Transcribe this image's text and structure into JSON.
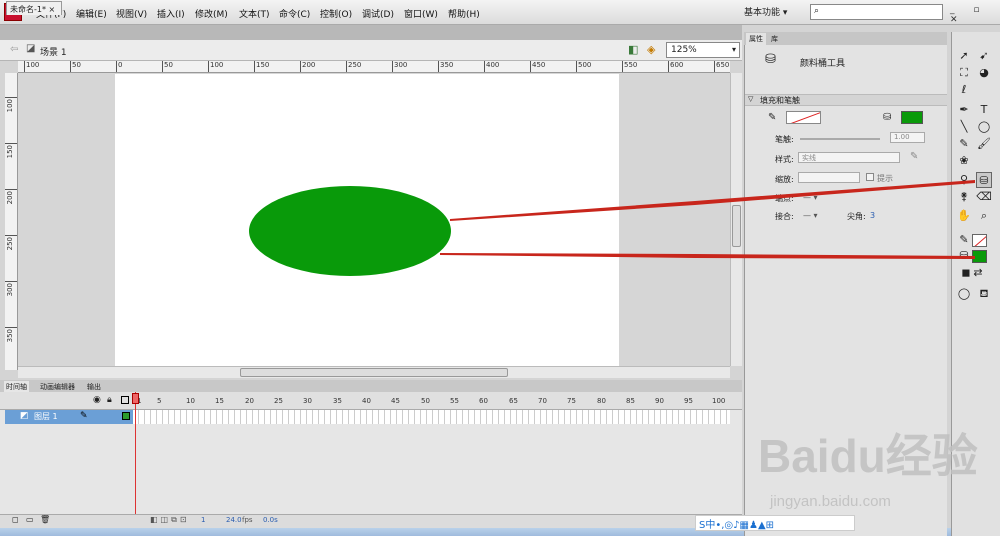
{
  "app": {
    "logo": "Fl"
  },
  "menu": [
    "文件(F)",
    "编辑(E)",
    "视图(V)",
    "插入(I)",
    "修改(M)",
    "文本(T)",
    "命令(C)",
    "控制(O)",
    "调试(D)",
    "窗口(W)",
    "帮助(H)"
  ],
  "workspace": "基本功能 ▾",
  "window_controls": "_ ▫ ✕",
  "document": {
    "tab": "未命名-1*",
    "close": "×",
    "scene": "场景 1",
    "zoom": "125%"
  },
  "ruler_h": [
    "100",
    "50",
    "0",
    "50",
    "100",
    "150",
    "200",
    "250",
    "300",
    "350",
    "400",
    "450",
    "500",
    "550",
    "600",
    "650"
  ],
  "ruler_v": [
    "100",
    "150",
    "200",
    "250",
    "300",
    "350"
  ],
  "timeline": {
    "tabs": [
      "时间轴",
      "动画编辑器",
      "输出"
    ],
    "frame_numbers": [
      "1",
      "5",
      "10",
      "15",
      "20",
      "25",
      "30",
      "35",
      "40",
      "45",
      "50",
      "55",
      "60",
      "65",
      "70",
      "75",
      "80",
      "85",
      "90",
      "95",
      "100"
    ],
    "layer_name": "图层 1",
    "current_frame": "1",
    "fps": "24.0",
    "fps_unit": "fps",
    "time": "0.0s"
  },
  "properties": {
    "tabs": [
      "属性",
      "库"
    ],
    "tool_name": "颜料桶工具",
    "section": "填充和笔触",
    "stroke_label": "笔触:",
    "stroke_value": "1.00",
    "style_label": "样式:",
    "style_value": "实线",
    "scale_label": "缩放:",
    "hint_label": "提示",
    "cap_label": "端点:",
    "join_label": "接合:",
    "miter_label": "尖角:",
    "miter_value": "3",
    "fill_color": "#0a9a0a"
  },
  "watermark": {
    "brand": "Baidu经验",
    "url": "jingyan.baidu.com"
  },
  "ime": "S中•,◎♪▦♟▲⊞",
  "colors": {
    "ellipse": "#099a0a",
    "arrow": "#c8261c"
  }
}
